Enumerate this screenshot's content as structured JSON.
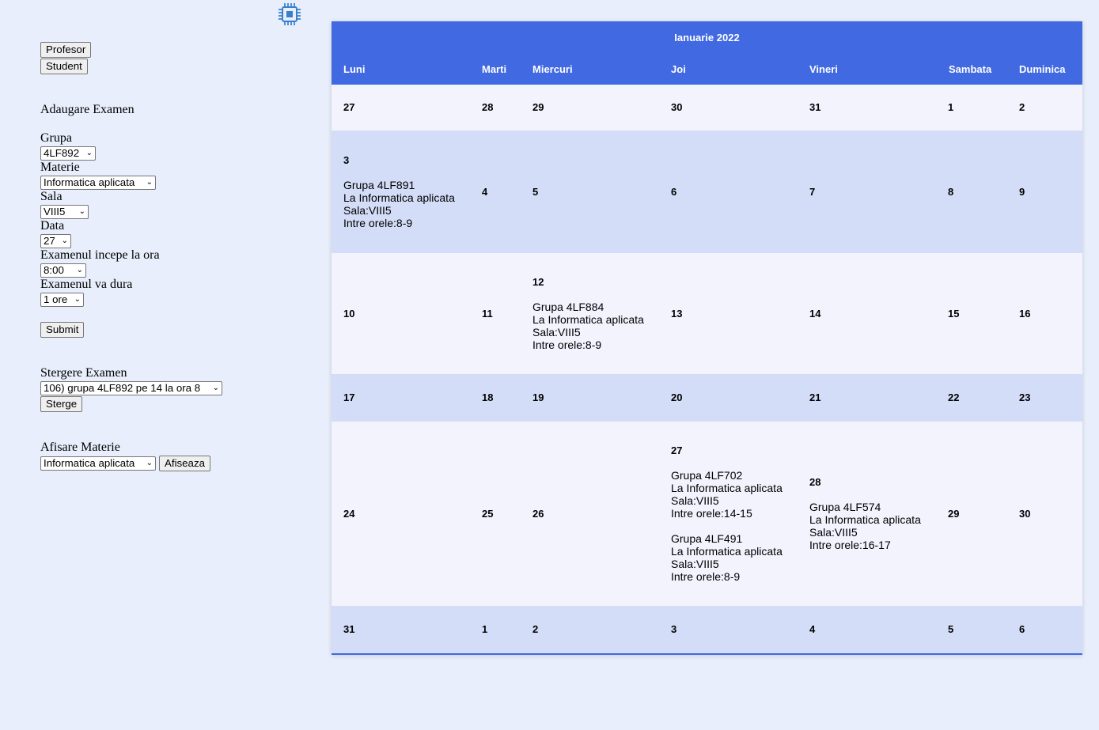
{
  "roles": {
    "profesor": "Profesor",
    "student": "Student"
  },
  "add_exam": {
    "title": "Adaugare Examen",
    "grupa_label": "Grupa",
    "grupa_value": "4LF892",
    "materie_label": "Materie",
    "materie_value": "Informatica aplicata",
    "sala_label": "Sala",
    "sala_value": "VIII5",
    "data_label": "Data",
    "data_value": "27",
    "start_label": "Examenul incepe la ora",
    "start_value": "8:00",
    "duration_label": "Examenul va dura",
    "duration_value": "1 ore",
    "submit": "Submit"
  },
  "delete_exam": {
    "title": "Stergere Examen",
    "value": "106) grupa 4LF892 pe 14 la ora 8",
    "button": "Sterge"
  },
  "show_subject": {
    "title": "Afisare Materie",
    "value": "Informatica aplicata",
    "button": "Afiseaza"
  },
  "calendar": {
    "month": "Ianuarie 2022",
    "days": [
      "Luni",
      "Marti",
      "Miercuri",
      "Joi",
      "Vineri",
      "Sambata",
      "Duminica"
    ],
    "weeks": [
      {
        "cells": [
          {
            "day": "27",
            "events": []
          },
          {
            "day": "28",
            "events": []
          },
          {
            "day": "29",
            "events": []
          },
          {
            "day": "30",
            "events": []
          },
          {
            "day": "31",
            "events": []
          },
          {
            "day": "1",
            "events": []
          },
          {
            "day": "2",
            "events": []
          }
        ]
      },
      {
        "cells": [
          {
            "day": "3",
            "events": [
              {
                "grupa": "Grupa 4LF891",
                "materie": "La Informatica aplicata",
                "sala": "Sala:VIII5",
                "ore": "Intre orele:8-9"
              }
            ]
          },
          {
            "day": "4",
            "events": []
          },
          {
            "day": "5",
            "events": []
          },
          {
            "day": "6",
            "events": []
          },
          {
            "day": "7",
            "events": []
          },
          {
            "day": "8",
            "events": []
          },
          {
            "day": "9",
            "events": []
          }
        ]
      },
      {
        "cells": [
          {
            "day": "10",
            "events": []
          },
          {
            "day": "11",
            "events": []
          },
          {
            "day": "12",
            "events": [
              {
                "grupa": "Grupa 4LF884",
                "materie": "La Informatica aplicata",
                "sala": "Sala:VIII5",
                "ore": "Intre orele:8-9"
              }
            ]
          },
          {
            "day": "13",
            "events": []
          },
          {
            "day": "14",
            "events": []
          },
          {
            "day": "15",
            "events": []
          },
          {
            "day": "16",
            "events": []
          }
        ]
      },
      {
        "cells": [
          {
            "day": "17",
            "events": []
          },
          {
            "day": "18",
            "events": []
          },
          {
            "day": "19",
            "events": []
          },
          {
            "day": "20",
            "events": []
          },
          {
            "day": "21",
            "events": []
          },
          {
            "day": "22",
            "events": []
          },
          {
            "day": "23",
            "events": []
          }
        ]
      },
      {
        "cells": [
          {
            "day": "24",
            "events": []
          },
          {
            "day": "25",
            "events": []
          },
          {
            "day": "26",
            "events": []
          },
          {
            "day": "27",
            "events": [
              {
                "grupa": "Grupa 4LF702",
                "materie": "La Informatica aplicata",
                "sala": "Sala:VIII5",
                "ore": "Intre orele:14-15"
              },
              {
                "grupa": "Grupa 4LF491",
                "materie": "La Informatica aplicata",
                "sala": "Sala:VIII5",
                "ore": "Intre orele:8-9"
              }
            ]
          },
          {
            "day": "28",
            "events": [
              {
                "grupa": "Grupa 4LF574",
                "materie": "La Informatica aplicata",
                "sala": "Sala:VIII5",
                "ore": "Intre orele:16-17"
              }
            ]
          },
          {
            "day": "29",
            "events": []
          },
          {
            "day": "30",
            "events": []
          }
        ]
      },
      {
        "cells": [
          {
            "day": "31",
            "events": []
          },
          {
            "day": "1",
            "events": []
          },
          {
            "day": "2",
            "events": []
          },
          {
            "day": "3",
            "events": []
          },
          {
            "day": "4",
            "events": []
          },
          {
            "day": "5",
            "events": []
          },
          {
            "day": "6",
            "events": []
          }
        ]
      }
    ]
  }
}
